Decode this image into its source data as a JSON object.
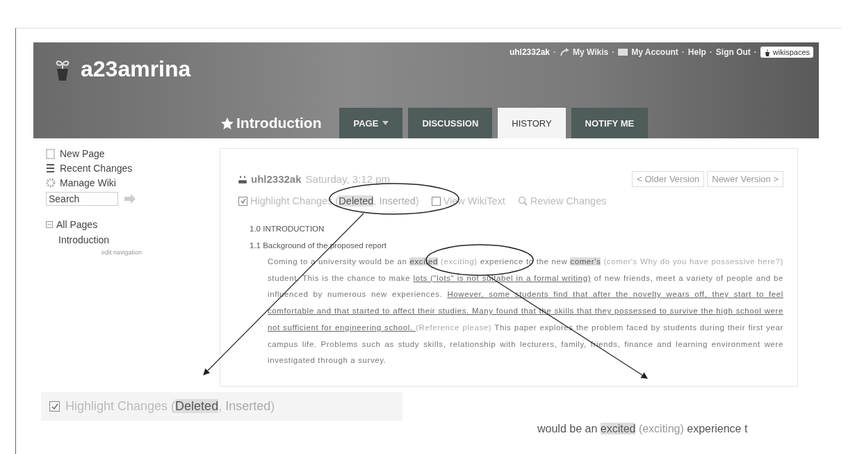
{
  "header": {
    "site_title": "a23amrina",
    "user_links": [
      {
        "text": "uhl2332ak",
        "kind": "user"
      },
      {
        "text": "My Wikis",
        "kind": "wikis"
      },
      {
        "text": "My Account",
        "kind": "account"
      },
      {
        "text": "Help",
        "kind": "plain"
      },
      {
        "text": "Sign Out",
        "kind": "plain"
      }
    ],
    "separator": "·",
    "brand": "wikispaces",
    "page_title": "Introduction",
    "tabs": [
      {
        "label": "PAGE",
        "selected": false,
        "dropdown": true
      },
      {
        "label": "DISCUSSION",
        "selected": false,
        "dropdown": false
      },
      {
        "label": "HISTORY",
        "selected": true,
        "dropdown": false
      },
      {
        "label": "NOTIFY ME",
        "selected": false,
        "dropdown": false
      }
    ]
  },
  "sidebar": {
    "items": [
      {
        "label": "New Page",
        "kind": "new"
      },
      {
        "label": "Recent Changes",
        "kind": "recent"
      },
      {
        "label": "Manage Wiki",
        "kind": "manage"
      }
    ],
    "search": {
      "placeholder": "Search"
    },
    "tree": {
      "label": "All Pages",
      "expanded": true,
      "children": [
        {
          "label": "Introduction"
        }
      ]
    },
    "edit_link": "edit navigation"
  },
  "revision": {
    "author": "uhl2332ak",
    "time": "Saturday, 3:12 pm",
    "nav_buttons": [
      "< Older Version",
      "Newer Version >"
    ],
    "options": [
      {
        "kind": "highlight",
        "checked": true,
        "segments": [
          {
            "text": "Highlight Changes (",
            "kind": "plain"
          },
          {
            "text": "Deleted",
            "kind": "deleted"
          },
          {
            "text": ", ",
            "kind": "plain"
          },
          {
            "text": "Inserted",
            "kind": "inserted"
          },
          {
            "text": ")",
            "kind": "plain"
          }
        ]
      },
      {
        "kind": "wikitext",
        "checked": false,
        "segments": [
          {
            "text": "View WikiText",
            "kind": "plain"
          }
        ]
      },
      {
        "kind": "review",
        "segments": [
          {
            "text": "Review Changes",
            "kind": "plain"
          }
        ]
      }
    ]
  },
  "document": {
    "heading": "1.0 INTRODUCTION",
    "subheading": "1.1 Background of the proposed report",
    "paragraph": [
      {
        "text": "Coming to a university would be an ",
        "kind": "plain"
      },
      {
        "text": "excited",
        "kind": "deleted"
      },
      {
        "text": " (exciting)",
        "kind": "inserted"
      },
      {
        "text": " experience to the new ",
        "kind": "plain"
      },
      {
        "text": "comer's",
        "kind": "deleted"
      },
      {
        "text": " (comer's Why do you have possessive here?)",
        "kind": "inserted"
      },
      {
        "text": " student. This is the chance to make ",
        "kind": "plain"
      },
      {
        "text": "lots (\"lots\" is not suitabel in a formal writing)",
        "kind": "underlined"
      },
      {
        "text": " of new friends, meet a variety of people and be influenced by numerous new experiences. ",
        "kind": "plain"
      },
      {
        "text": "However, some students find that after the novelty wears off, they start to feel comfortable and that started to affect their studies. Many found that the skills that they possessed to survive the high school were not sufficient for engineering school. ",
        "kind": "underlined"
      },
      {
        "text": "(Reference please)",
        "kind": "inserted"
      },
      {
        "text": " This paper explores the problem faced by students during their first year campus life. Problems such as study skills, relationship with lecturers, family, friends, finance and learning environment were investigated through a survey.",
        "kind": "plain"
      }
    ]
  },
  "insets": [
    {
      "kind": "option",
      "checked": true,
      "segments": [
        {
          "text": "Highlight Changes (",
          "kind": "plain"
        },
        {
          "text": "Deleted",
          "kind": "deleted"
        },
        {
          "text": ", ",
          "kind": "plain"
        },
        {
          "text": "Inserted",
          "kind": "inserted"
        },
        {
          "text": ")",
          "kind": "plain"
        }
      ]
    },
    {
      "kind": "text",
      "segments": [
        {
          "text": "would be an ",
          "kind": "plain"
        },
        {
          "text": "excited",
          "kind": "deleted"
        },
        {
          "text": " (exciting)",
          "kind": "inserted"
        },
        {
          "text": " experience t",
          "kind": "plain"
        }
      ]
    }
  ]
}
